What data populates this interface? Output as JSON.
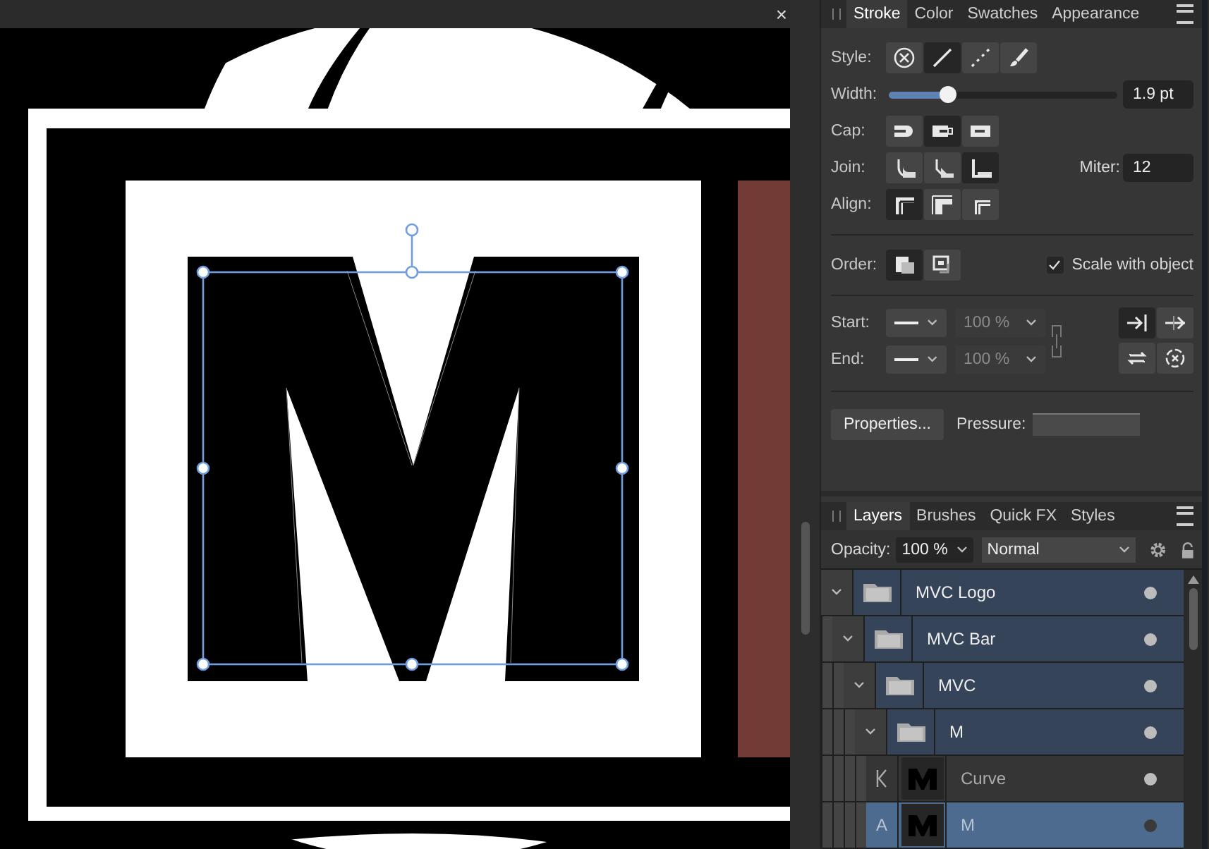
{
  "canvas": {
    "close_label": "×"
  },
  "stroke_panel": {
    "tabs": [
      {
        "label": "Stroke",
        "selected": true
      },
      {
        "label": "Color",
        "selected": false
      },
      {
        "label": "Swatches",
        "selected": false
      },
      {
        "label": "Appearance",
        "selected": false
      }
    ],
    "style": {
      "label": "Style:",
      "options": [
        {
          "kind": "none",
          "selected": false
        },
        {
          "kind": "solid",
          "selected": true
        },
        {
          "kind": "dashed",
          "selected": false
        },
        {
          "kind": "brush",
          "selected": false
        }
      ]
    },
    "width": {
      "label": "Width:",
      "level": 0.26,
      "value": "1.9 pt"
    },
    "cap": {
      "label": "Cap:",
      "options": [
        {
          "kind": "cap-round",
          "selected": false
        },
        {
          "kind": "cap-butt",
          "selected": true
        },
        {
          "kind": "cap-square",
          "selected": false
        }
      ]
    },
    "join": {
      "label": "Join:",
      "options": [
        {
          "kind": "join-round",
          "selected": false
        },
        {
          "kind": "join-bevel",
          "selected": false
        },
        {
          "kind": "join-miter",
          "selected": true
        }
      ],
      "miter_label": "Miter:",
      "miter_value": "12"
    },
    "align": {
      "label": "Align:",
      "options": [
        {
          "kind": "align-inside",
          "selected": true
        },
        {
          "kind": "align-center",
          "selected": false
        },
        {
          "kind": "align-outside",
          "selected": false
        }
      ]
    },
    "order": {
      "label": "Order:",
      "options": [
        {
          "kind": "order-behind",
          "selected": true
        },
        {
          "kind": "order-front",
          "selected": false
        }
      ]
    },
    "scale_with_object": {
      "label": "Scale with object",
      "checked": true
    },
    "start": {
      "label": "Start:",
      "percent": "100 %"
    },
    "end": {
      "label": "End:",
      "percent": "100 %"
    },
    "arrow_buttons": [
      {
        "kind": "arrow-at-end",
        "selected": true
      },
      {
        "kind": "arrow-through",
        "selected": false
      },
      {
        "kind": "swap",
        "selected": false
      },
      {
        "kind": "reset",
        "selected": false
      }
    ],
    "properties_button": "Properties...",
    "pressure_label": "Pressure:"
  },
  "layers_panel": {
    "tabs": [
      {
        "label": "Layers",
        "selected": true
      },
      {
        "label": "Brushes",
        "selected": false
      },
      {
        "label": "Quick FX",
        "selected": false
      },
      {
        "label": "Styles",
        "selected": false
      }
    ],
    "opacity_label": "Opacity:",
    "opacity_value": "100 %",
    "blend_mode": "Normal",
    "layers": [
      {
        "name": "MVC Logo",
        "kind": "group",
        "expanded": true,
        "selected": false,
        "children": [
          {
            "name": "MVC Bar",
            "kind": "group",
            "expanded": true,
            "selected": false,
            "children": [
              {
                "name": "MVC",
                "kind": "group",
                "expanded": true,
                "selected": false,
                "children": [
                  {
                    "name": "M",
                    "kind": "group",
                    "expanded": true,
                    "selected": false,
                    "children": [
                      {
                        "name": "Curve",
                        "kind": "curve",
                        "selected": false
                      },
                      {
                        "name": "M",
                        "kind": "text",
                        "badge": "A",
                        "selected": true
                      }
                    ]
                  }
                ]
              }
            ]
          }
        ]
      }
    ]
  }
}
